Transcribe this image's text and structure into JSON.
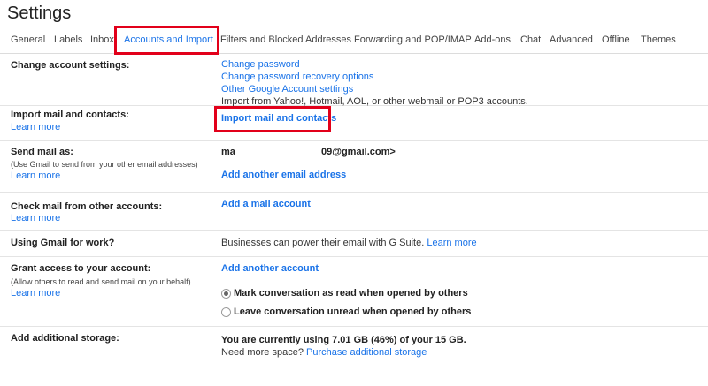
{
  "page": {
    "title": "Settings"
  },
  "tabs": [
    {
      "label": "General"
    },
    {
      "label": "Labels"
    },
    {
      "label": "Inbox"
    },
    {
      "label": "Accounts and Import",
      "active": true
    },
    {
      "label": "Filters and Blocked Addresses"
    },
    {
      "label": "Forwarding and POP/IMAP"
    },
    {
      "label": "Add-ons"
    },
    {
      "label": "Chat"
    },
    {
      "label": "Advanced"
    },
    {
      "label": "Offline"
    },
    {
      "label": "Themes"
    }
  ],
  "sections": {
    "change_account": {
      "label": "Change account settings:",
      "links": [
        "Change password",
        "Change password recovery options",
        "Other Google Account settings"
      ]
    },
    "import_mail": {
      "label": "Import mail and contacts:",
      "learn_more": "Learn more",
      "note": "Import from Yahoo!, Hotmail, AOL, or other webmail or POP3 accounts.",
      "action": "Import mail and contacts"
    },
    "send_mail": {
      "label": "Send mail as:",
      "sub": "(Use Gmail to send from your other email addresses)",
      "learn_more": "Learn more",
      "name": "ma",
      "email": "09@gmail.com>",
      "action": "Add another email address"
    },
    "check_mail": {
      "label": "Check mail from other accounts:",
      "learn_more": "Learn more",
      "action": "Add a mail account"
    },
    "gsuite": {
      "label": "Using Gmail for work?",
      "text": "Businesses can power their email with G Suite.",
      "learn_more": "Learn more"
    },
    "grant_access": {
      "label": "Grant access to your account:",
      "sub": "(Allow others to read and send mail on your behalf)",
      "learn_more": "Learn more",
      "action": "Add another account",
      "options": [
        {
          "label": "Mark conversation as read when opened by others",
          "checked": true
        },
        {
          "label": "Leave conversation unread when opened by others",
          "checked": false
        }
      ]
    },
    "storage": {
      "label": "Add additional storage:",
      "usage": "You are currently using 7.01 GB (46%) of your 15 GB.",
      "need_more": "Need more space?",
      "purchase": "Purchase additional storage"
    }
  },
  "colors": {
    "link": "#1a73e8",
    "highlight": "#e2001a"
  }
}
